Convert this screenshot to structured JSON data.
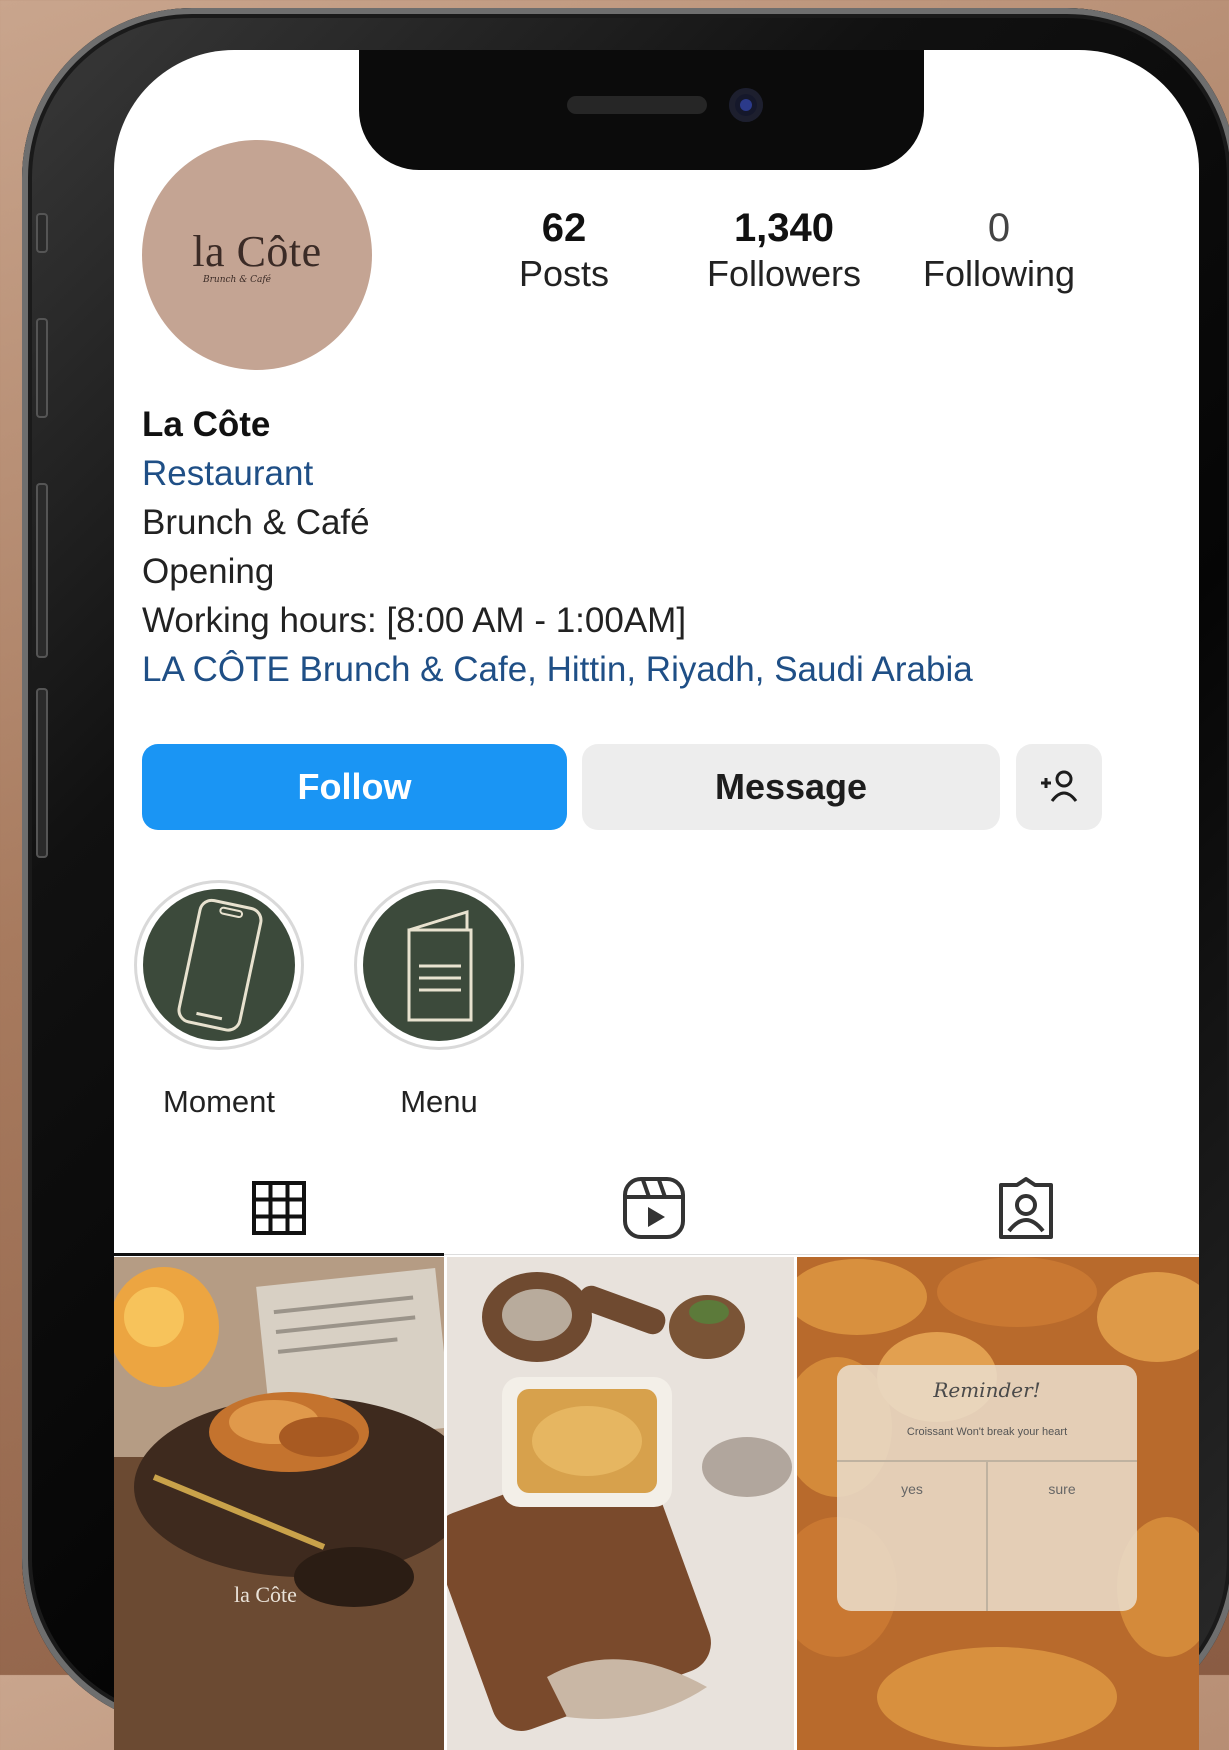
{
  "avatar": {
    "logo_name": "la Côte",
    "logo_sub": "Brunch & Café"
  },
  "stats": [
    {
      "value": "62",
      "label": "Posts"
    },
    {
      "value": "1,340",
      "label": "Followers"
    },
    {
      "value": "0",
      "label": "Following"
    }
  ],
  "bio": {
    "name": "La Côte",
    "category": "Restaurant",
    "line1": "Brunch & Café",
    "line2": "Opening",
    "line3": "Working hours: [8:00 AM - 1:00AM]",
    "location": "LA CÔTE Brunch & Cafe, Hittin, Riyadh, Saudi Arabia"
  },
  "actions": {
    "follow": "Follow",
    "message": "Message"
  },
  "highlights": [
    {
      "label": "Moment",
      "icon": "phone-icon"
    },
    {
      "label": "Menu",
      "icon": "menu-book-icon"
    }
  ],
  "tabs": [
    {
      "icon": "grid-icon",
      "active": true
    },
    {
      "icon": "reels-icon",
      "active": false
    },
    {
      "icon": "tagged-icon",
      "active": false
    }
  ],
  "posts": [
    {
      "watermark": "la Côte"
    },
    {},
    {
      "title": "Reminder!",
      "text": "Croissant Won't break your heart",
      "left": "yes",
      "right": "sure"
    }
  ],
  "colors": {
    "accent": "#1a95f4",
    "link": "#1f4f86",
    "highlight": "#3c4a3b",
    "avatar_bg": "#c4a493"
  }
}
